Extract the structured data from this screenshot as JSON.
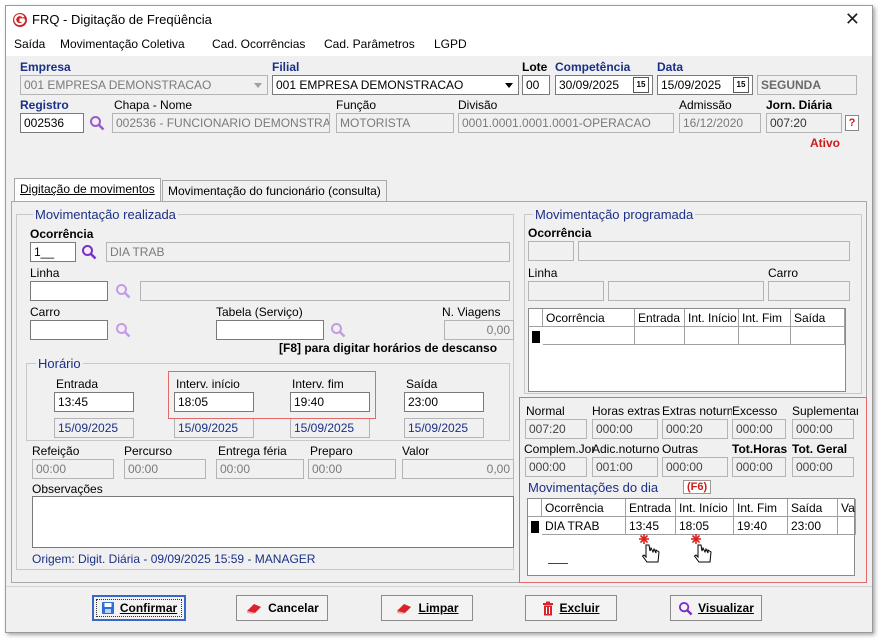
{
  "window": {
    "title": "FRQ - Digitação de Freqüência"
  },
  "menu": [
    "Saída",
    "Movimentação Coletiva",
    "Cad. Ocorrências",
    "Cad. Parâmetros",
    "LGPD"
  ],
  "header": {
    "empresa_label": "Empresa",
    "empresa_value": "001 EMPRESA DEMONSTRACAO",
    "filial_label": "Filial",
    "filial_value": "001 EMPRESA DEMONSTRACAO",
    "lote_label": "Lote",
    "lote_value": "00",
    "competencia_label": "Competência",
    "competencia_value": "30/09/2025",
    "data_label": "Data",
    "data_value": "15/09/2025",
    "weekday": "SEGUNDA",
    "registro_label": "Registro",
    "registro_value": "002536",
    "chapa_label": "Chapa - Nome",
    "chapa_value": "002536 - FUNCIONARIO DEMONSTRAC",
    "funcao_label": "Função",
    "funcao_value": "MOTORISTA",
    "divisao_label": "Divisão",
    "divisao_value": "0001.0001.0001.0001-OPERACAO",
    "admissao_label": "Admissão",
    "admissao_value": "16/12/2020",
    "jornada_label": "Jorn. Diária",
    "jornada_value": "007:20",
    "help": "?",
    "status": "Ativo",
    "cal_icon_text": "15"
  },
  "tabs": [
    "Digitação de movimentos",
    "Movimentação do funcionário (consulta)"
  ],
  "realizada": {
    "title": "Movimentação realizada",
    "ocorrencia_label": "Ocorrência",
    "ocorrencia_code": "1__",
    "ocorrencia_desc": "DIA TRAB",
    "linha_label": "Linha",
    "carro_label": "Carro",
    "tabela_label": "Tabela (Serviço)",
    "nviagens_label": "N. Viagens",
    "nviagens_value": "0,00",
    "f8_hint": "[F8] para digitar horários de descanso",
    "horario_title": "Horário",
    "entrada_label": "Entrada",
    "entrada_value": "13:45",
    "entrada_date": "15/09/2025",
    "int_inicio_label": "Interv. início",
    "int_inicio_value": "18:05",
    "int_inicio_date": "15/09/2025",
    "int_fim_label": "Interv. fim",
    "int_fim_value": "19:40",
    "int_fim_date": "15/09/2025",
    "saida_label": "Saída",
    "saida_value": "23:00",
    "saida_date": "15/09/2025",
    "refeicao_label": "Refeição",
    "refeicao_value": "00:00",
    "percurso_label": "Percurso",
    "percurso_value": "00:00",
    "entrega_label": "Entrega féria",
    "entrega_value": "00:00",
    "preparo_label": "Preparo",
    "preparo_value": "00:00",
    "valor_label": "Valor",
    "valor_value": "0,00",
    "obs_label": "Observações",
    "origem": "Origem: Digit. Diária - 09/09/2025 15:59 - MANAGER"
  },
  "programada": {
    "title": "Movimentação programada",
    "ocorrencia_label": "Ocorrência",
    "linha_label": "Linha",
    "carro_label": "Carro",
    "grid_headers": [
      "Ocorrência",
      "Entrada",
      "Int. Início",
      "Int. Fim",
      "Saída"
    ]
  },
  "totals": {
    "normal_label": "Normal",
    "normal_value": "007:20",
    "horas_extras_label": "Horas extras",
    "horas_extras_value": "000:00",
    "extras_noturn_label": "Extras noturn.",
    "extras_noturn_value": "000:20",
    "excesso_label": "Excesso",
    "excesso_value": "000:00",
    "suplementar_label": "Suplementar",
    "suplementar_value": "000:00",
    "complem_label": "Complem.Jor.",
    "complem_value": "000:00",
    "adic_noturno_label": "Adic.noturno",
    "adic_noturno_value": "001:00",
    "outras_label": "Outras",
    "outras_value": "000:00",
    "tot_horas_label": "Tot.Horas",
    "tot_horas_value": "000:00",
    "tot_geral_label": "Tot. Geral",
    "tot_geral_value": "000:00"
  },
  "mov_dia": {
    "title": "Movimentações do dia",
    "shortcut": "(F6)",
    "headers": [
      "Ocorrência",
      "Entrada",
      "Int. Início",
      "Int. Fim",
      "Saída",
      "Va"
    ],
    "row": [
      "DIA TRAB",
      "13:45",
      "18:05",
      "19:40",
      "23:00",
      ""
    ]
  },
  "buttons": {
    "confirmar": "Confirmar",
    "cancelar": "Cancelar",
    "limpar": "Limpar",
    "excluir": "Excluir",
    "visualizar": "Visualizar"
  }
}
